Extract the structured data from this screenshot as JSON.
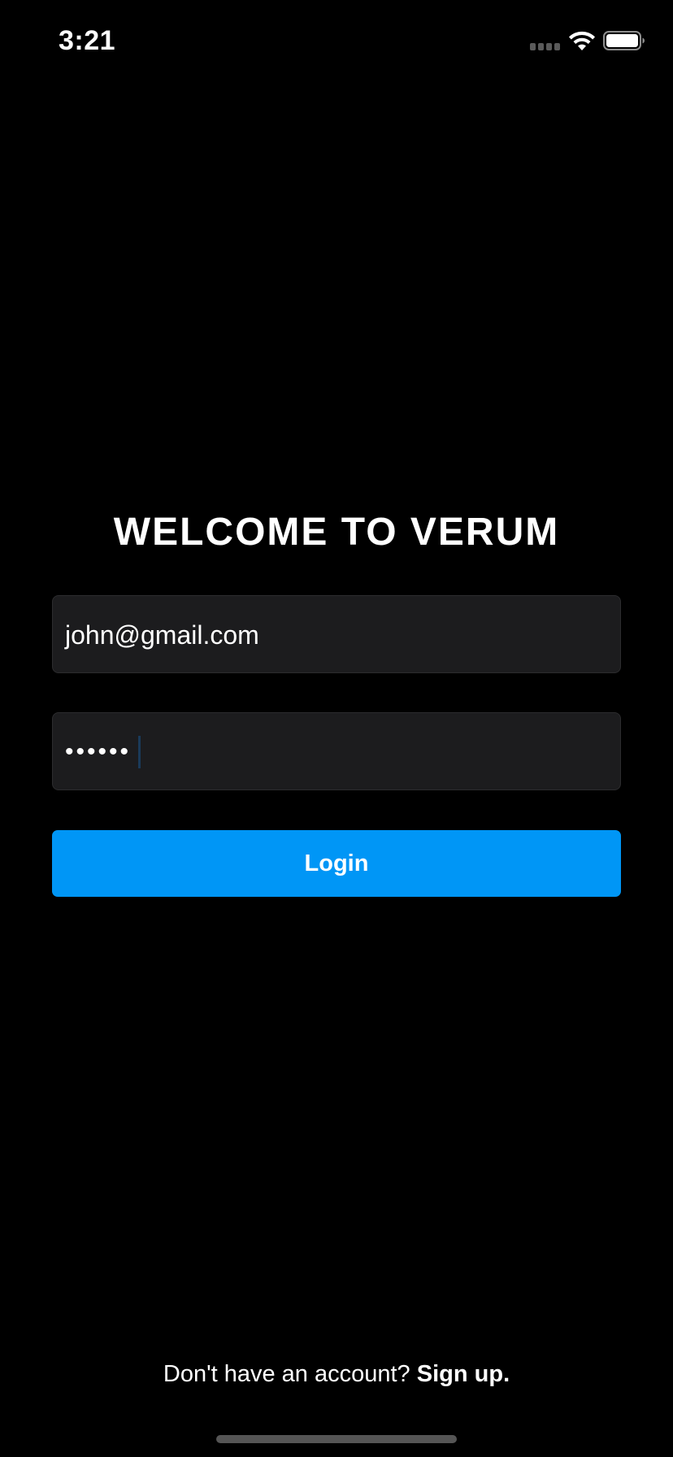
{
  "status_bar": {
    "time": "3:21",
    "icons": [
      "cell-signal-icon",
      "wifi-icon",
      "battery-icon"
    ]
  },
  "title": "WELCOME TO VERUM",
  "email_field": {
    "value": "john@gmail.com"
  },
  "password_field": {
    "masked_value": "••••••"
  },
  "login_button": {
    "label": "Login"
  },
  "signup": {
    "prompt": "Don't have an account? ",
    "link_label": "Sign up."
  },
  "colors": {
    "background": "#000000",
    "input_background": "#1c1c1e",
    "accent": "#0096f6"
  }
}
